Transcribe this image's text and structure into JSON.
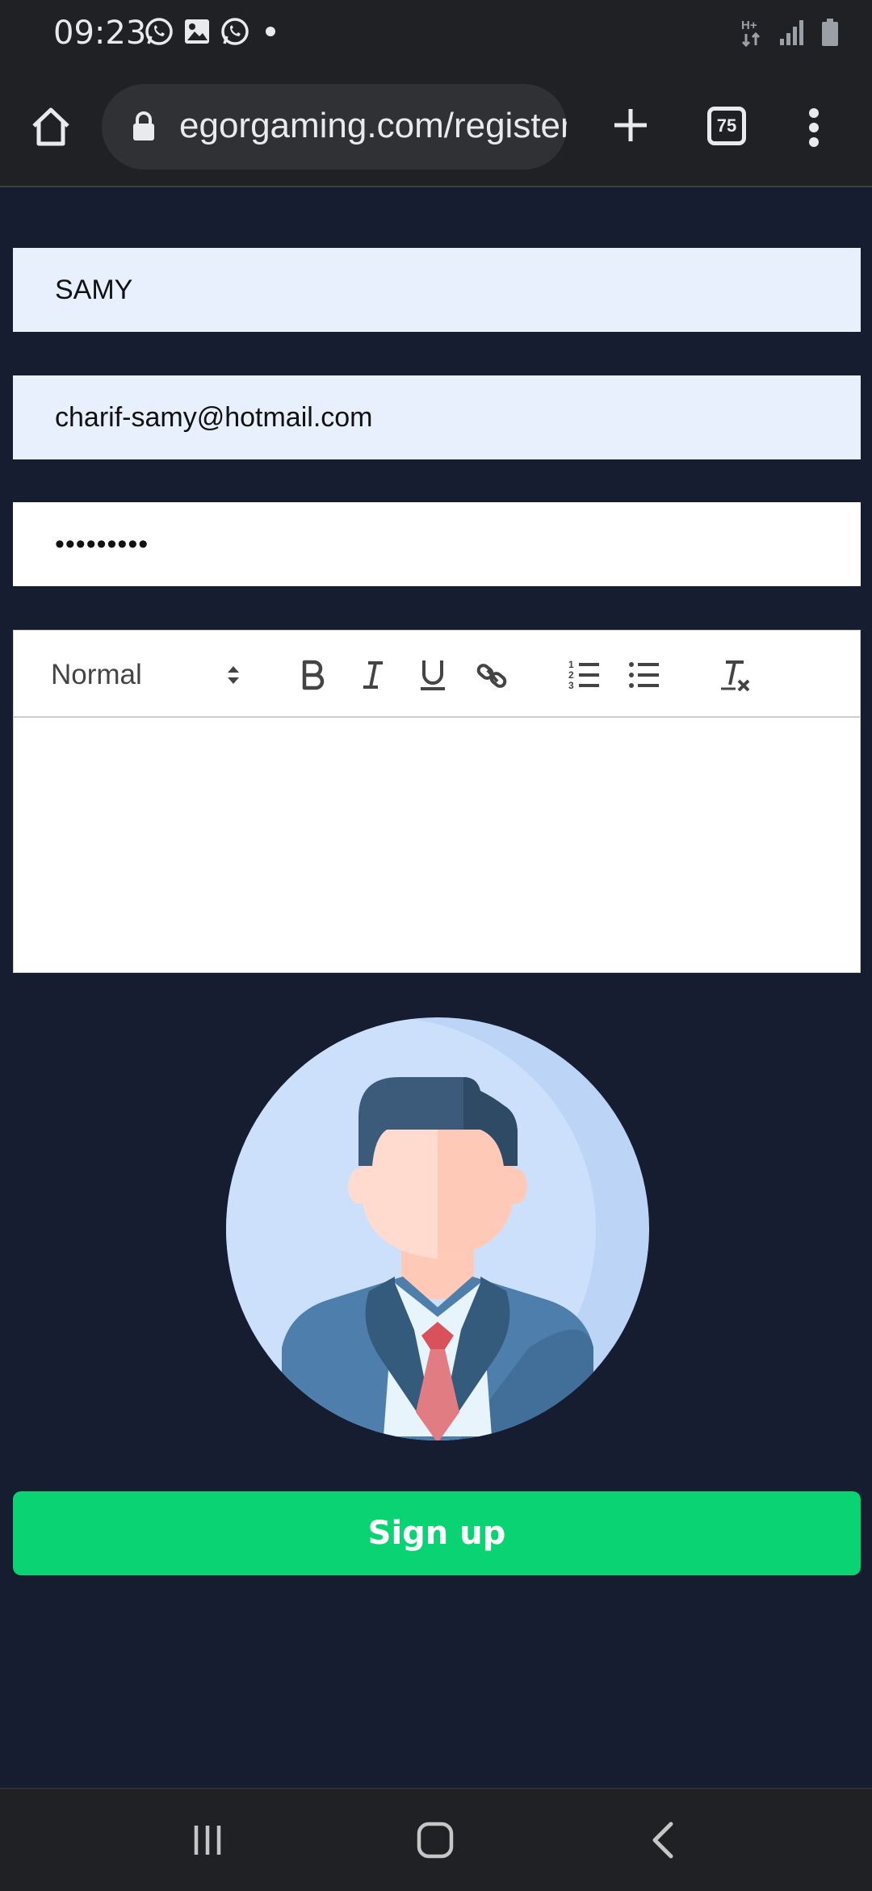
{
  "status_bar": {
    "time": "09:23",
    "notification_icons": [
      "whatsapp-icon",
      "gallery-icon",
      "whatsapp-icon",
      "dot-icon"
    ],
    "network_label": "H+",
    "system_icons": [
      "network-type-icon",
      "signal-icon",
      "battery-icon"
    ]
  },
  "browser": {
    "url": "egorgaming.com/register",
    "tab_count": "75",
    "icons": [
      "home-icon",
      "lock-icon",
      "plus-icon",
      "tabs-icon",
      "more-vert-icon"
    ]
  },
  "form": {
    "name_value": "SAMY",
    "email_value": "charif-samy@hotmail.com",
    "password_value": "•••••••••"
  },
  "editor": {
    "format_select": "Normal",
    "toolbar_buttons": [
      "bold-icon",
      "italic-icon",
      "underline-icon",
      "link-icon",
      "ordered-list-icon",
      "bullet-list-icon",
      "clear-format-icon"
    ],
    "content": ""
  },
  "avatar": {
    "icon": "businessman-avatar-icon",
    "colors": {
      "circle": "#cce0fc",
      "circle_shade": "#bcd5f7",
      "hair": "#3c5b7a",
      "skin": "#ffdbcf",
      "skin_shade": "#ffc9b7",
      "suit": "#4e7fac",
      "lapel": "#355b7c",
      "shirt": "#e8f4fc",
      "tie": "#e27c83",
      "tie_knot": "#d9525b"
    }
  },
  "actions": {
    "signup_label": "Sign up",
    "signup_color": "#09d372"
  },
  "nav_bar": {
    "icons": [
      "recent-apps-icon",
      "home-icon",
      "back-icon"
    ]
  },
  "theme": {
    "page_background": "#161d31",
    "chrome_background": "#202124",
    "autofill_background": "#e8f0fe"
  }
}
